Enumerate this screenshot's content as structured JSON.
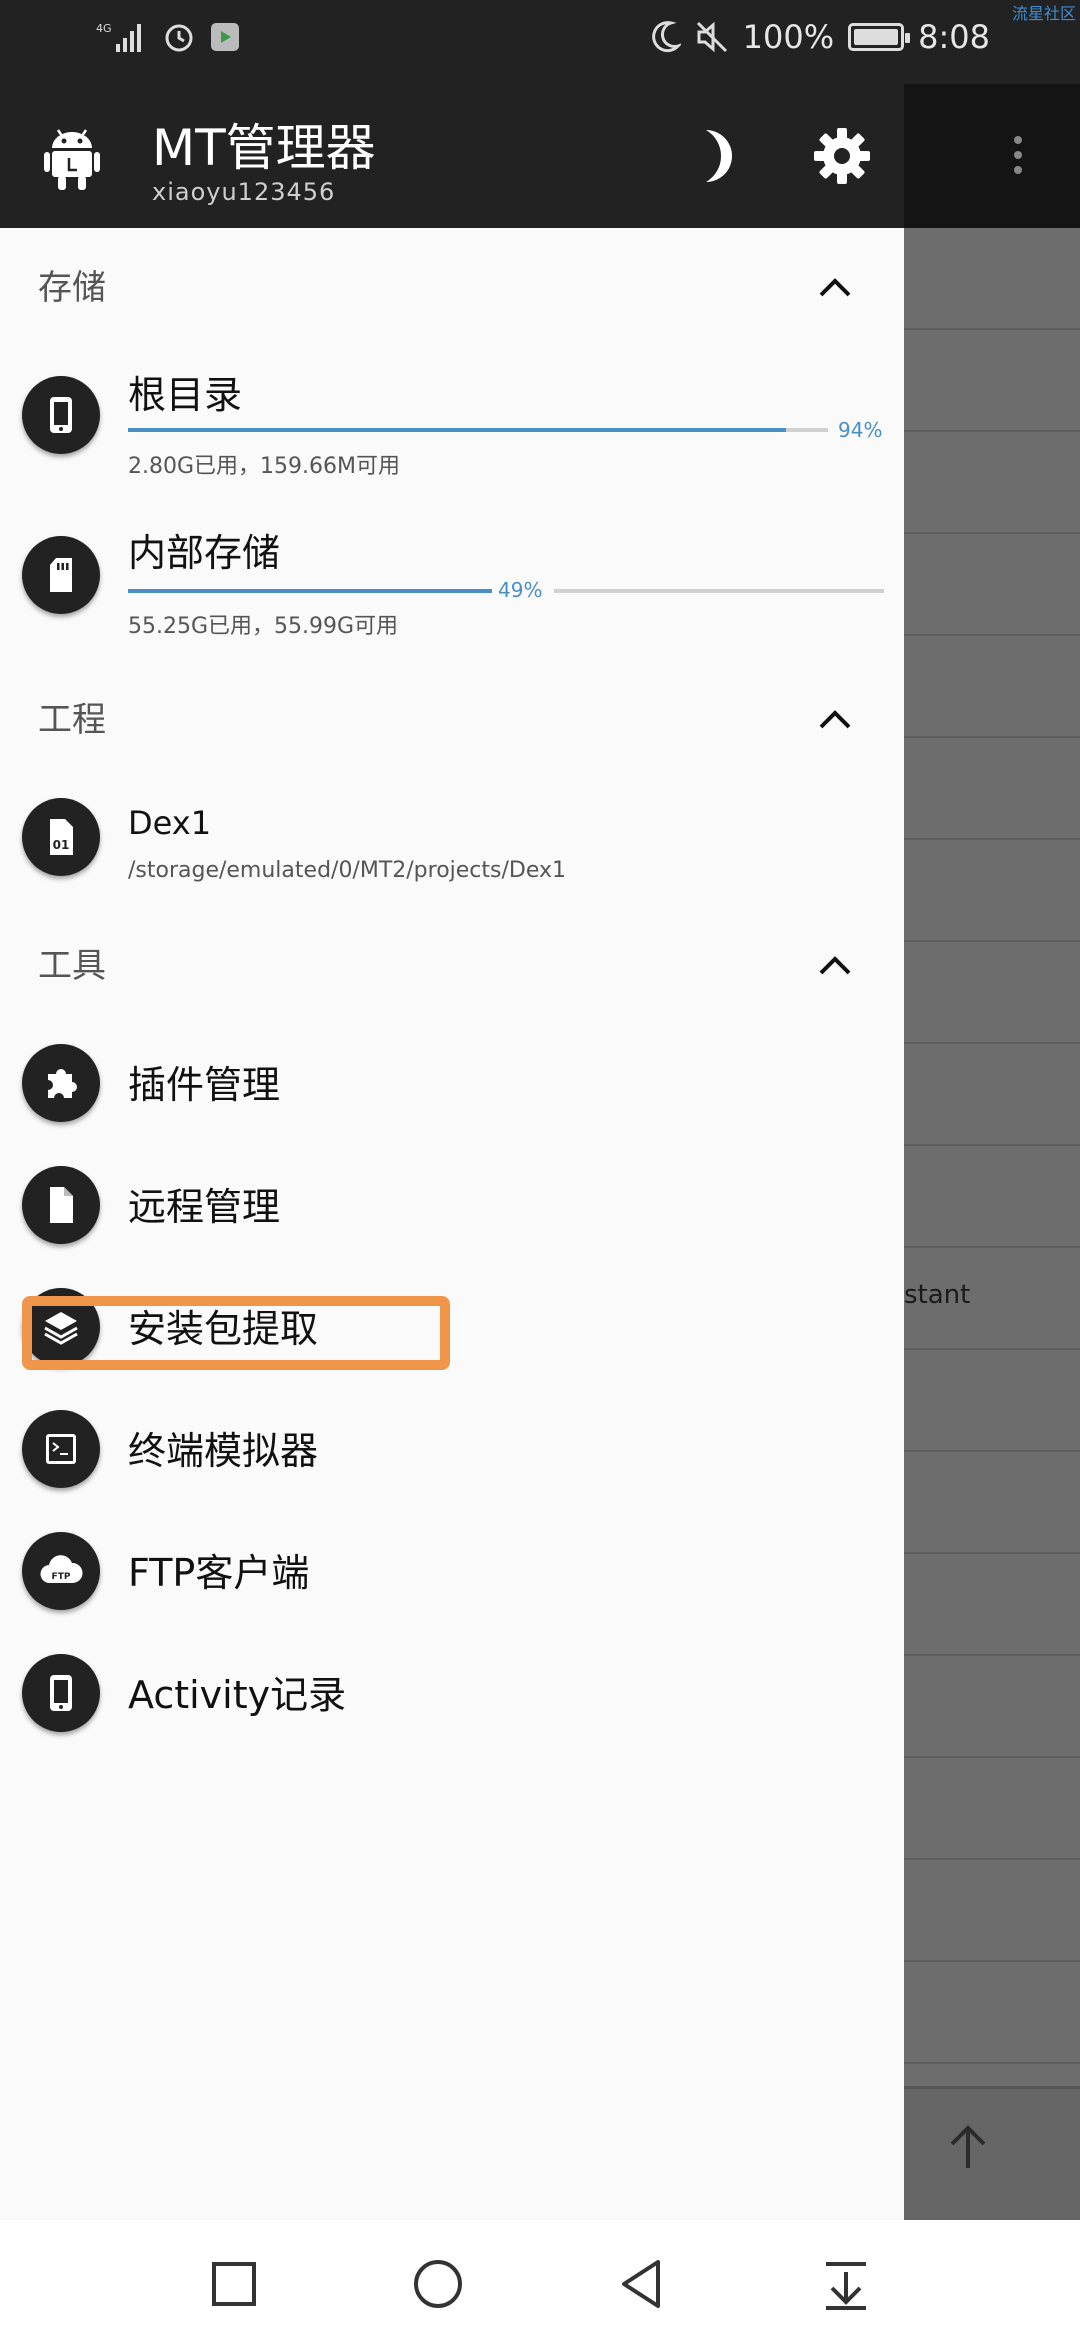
{
  "status_bar": {
    "network": "4G",
    "battery": "100%",
    "battery_level": 1.0,
    "time": "8:08",
    "watermark": "流星社区"
  },
  "drawer_header": {
    "title": "MT管理器",
    "user": "xiaoyu123456"
  },
  "sections": {
    "storage": {
      "title": "存储",
      "items": [
        {
          "name": "根目录",
          "usage": "2.80G已用，159.66M可用",
          "percent": "94%",
          "percent_value": 94
        },
        {
          "name": "内部存储",
          "usage": "55.25G已用，55.99G可用",
          "percent": "49%",
          "percent_value": 49
        }
      ]
    },
    "project": {
      "title": "工程",
      "items": [
        {
          "name": "Dex1",
          "path": "/storage/emulated/0/MT2/projects/Dex1"
        }
      ]
    },
    "tools": {
      "title": "工具",
      "items": [
        {
          "name": "插件管理",
          "icon": "puzzle-icon"
        },
        {
          "name": "远程管理",
          "icon": "file-icon"
        },
        {
          "name": "安装包提取",
          "icon": "layers-icon"
        },
        {
          "name": "终端模拟器",
          "icon": "terminal-icon"
        },
        {
          "name": "FTP客户端",
          "icon": "ftp-cloud-icon"
        },
        {
          "name": "Activity记录",
          "icon": "phone-icon"
        }
      ]
    }
  },
  "background": {
    "partial_text": "stant"
  },
  "colors": {
    "header_bg": "#222222",
    "progress": "#4a90c7",
    "highlight": "#f0964a"
  }
}
